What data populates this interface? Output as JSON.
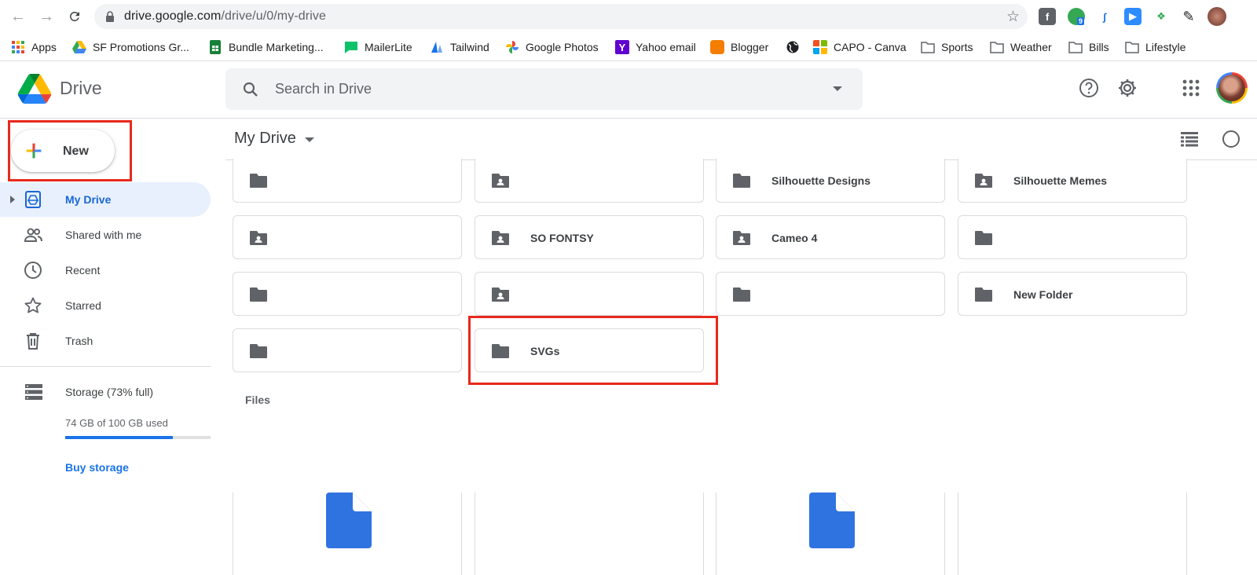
{
  "browser": {
    "url_host": "drive.google.com",
    "url_path": "/drive/u/0/my-drive",
    "bookmarks": [
      {
        "label": "Apps",
        "icon": "apps-grid-icon"
      },
      {
        "label": "SF Promotions Gr...",
        "icon": "google-drive-icon"
      },
      {
        "label": "Bundle Marketing...",
        "icon": "google-sheets-icon"
      },
      {
        "label": "MailerLite",
        "icon": "mailerlite-icon"
      },
      {
        "label": "Tailwind",
        "icon": "tailwind-icon"
      },
      {
        "label": "Google Photos",
        "icon": "google-photos-icon"
      },
      {
        "label": "Yahoo email",
        "icon": "yahoo-icon"
      },
      {
        "label": "Blogger",
        "icon": "blogger-icon"
      },
      {
        "label": "",
        "icon": "globe-icon"
      },
      {
        "label": "CAPO - Canva",
        "icon": "microsoft-icon"
      },
      {
        "label": "Sports",
        "icon": "folder-icon"
      },
      {
        "label": "Weather",
        "icon": "folder-icon"
      },
      {
        "label": "Bills",
        "icon": "folder-icon"
      },
      {
        "label": "Lifestyle",
        "icon": "folder-icon"
      }
    ],
    "extension_badge": "9"
  },
  "header": {
    "app_name": "Drive",
    "search_placeholder": "Search in Drive"
  },
  "sidebar": {
    "new_label": "New",
    "items": [
      {
        "label": "My Drive",
        "icon": "my-drive-icon",
        "active": true
      },
      {
        "label": "Shared with me",
        "icon": "people-icon",
        "active": false
      },
      {
        "label": "Recent",
        "icon": "clock-icon",
        "active": false
      },
      {
        "label": "Starred",
        "icon": "star-icon",
        "active": false
      },
      {
        "label": "Trash",
        "icon": "trash-icon",
        "active": false
      }
    ],
    "storage_label": "Storage (73% full)",
    "storage_used": "74 GB of 100 GB used",
    "storage_fraction": 0.74,
    "buy_storage": "Buy storage"
  },
  "main": {
    "breadcrumb": "My Drive",
    "folders": [
      {
        "name": "",
        "shared": false
      },
      {
        "name": "",
        "shared": true
      },
      {
        "name": "Silhouette Designs",
        "shared": false
      },
      {
        "name": "Silhouette Memes",
        "shared": true
      },
      {
        "name": "",
        "shared": true
      },
      {
        "name": "SO FONTSY",
        "shared": true
      },
      {
        "name": "Cameo 4",
        "shared": true
      },
      {
        "name": "",
        "shared": false
      },
      {
        "name": "",
        "shared": false
      },
      {
        "name": "",
        "shared": true
      },
      {
        "name": "",
        "shared": false
      },
      {
        "name": "New Folder",
        "shared": false
      },
      {
        "name": "",
        "shared": false
      },
      {
        "name": "SVGs",
        "shared": false
      }
    ],
    "files_label": "Files"
  },
  "colors": {
    "accent": "#1a73e8",
    "highlight_box": "#e8291c",
    "active_nav_bg": "#e8f0fe",
    "folder_icon": "#5f6368",
    "doc_icon": "#2f73e0"
  }
}
